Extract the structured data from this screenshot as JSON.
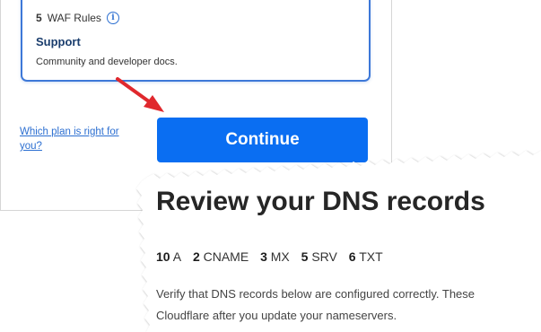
{
  "plan_card": {
    "waf_count": "5",
    "waf_label": "WAF Rules",
    "support_title": "Support",
    "support_desc": "Community and developer docs."
  },
  "links": {
    "which_plan": "Which plan is right for you?"
  },
  "buttons": {
    "continue": "Continue"
  },
  "dns_review": {
    "title": "Review your DNS records",
    "counts": [
      {
        "count": "10",
        "type": "A"
      },
      {
        "count": "2",
        "type": "CNAME"
      },
      {
        "count": "3",
        "type": "MX"
      },
      {
        "count": "5",
        "type": "SRV"
      },
      {
        "count": "6",
        "type": "TXT"
      }
    ],
    "desc_line1": "Verify that DNS records below are configured correctly. These",
    "desc_line2": "Cloudflare after you update your nameservers."
  },
  "colors": {
    "accent": "#0a6ef2",
    "card_border": "#3d78d8",
    "link": "#2c6fd1",
    "arrow": "#e0282d"
  },
  "icons": {
    "info": "info-icon",
    "arrow": "red-arrow-icon"
  }
}
